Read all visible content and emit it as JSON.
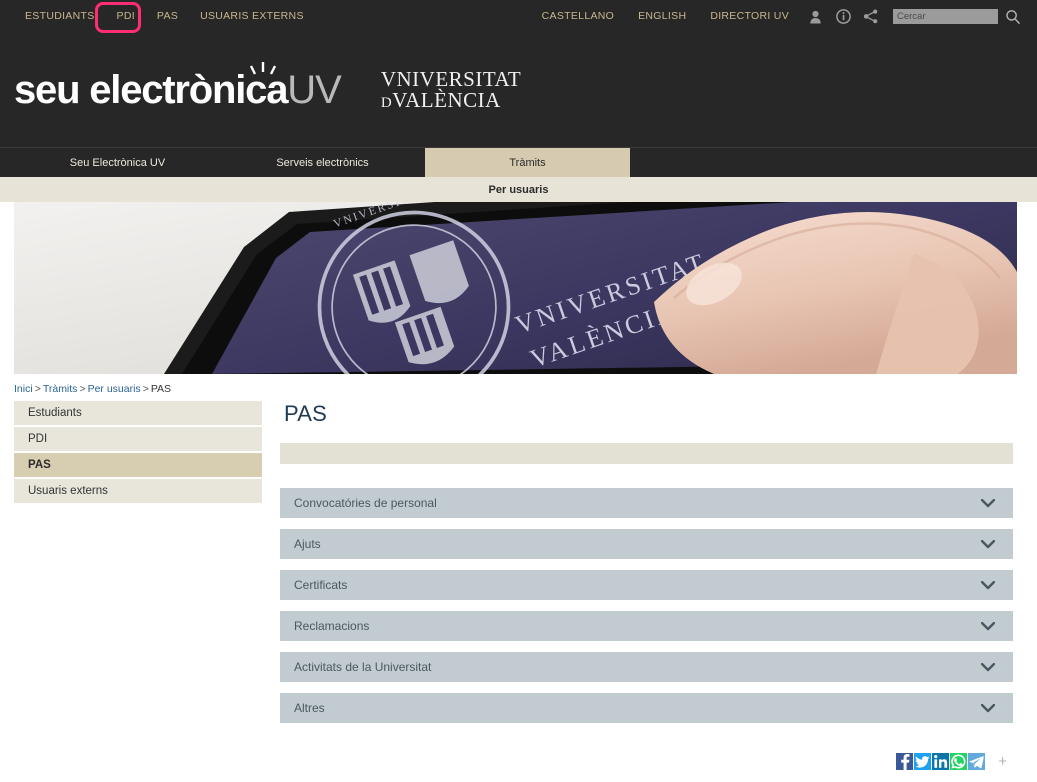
{
  "topbar": {
    "left_links": [
      {
        "label": "ESTUDIANTS",
        "name": "topnav-estudiants"
      },
      {
        "label": "PDI",
        "name": "topnav-pdi"
      },
      {
        "label": "PAS",
        "name": "topnav-pas"
      },
      {
        "label": "USUARIS EXTERNS",
        "name": "topnav-usuaris-externs"
      }
    ],
    "right_links": [
      {
        "label": "CASTELLANO",
        "name": "topnav-castellano"
      },
      {
        "label": "ENGLISH",
        "name": "topnav-english"
      },
      {
        "label": "DIRECTORI UV",
        "name": "topnav-directori-uv"
      }
    ],
    "icons": [
      "user-icon",
      "info-icon",
      "share-icon"
    ],
    "search": {
      "placeholder": "Cercar",
      "value": ""
    },
    "highlight_color": "#ff2d72",
    "highlighted_item": "PAS"
  },
  "banner": {
    "logo_main": "seu electr",
    "logo_mid": "nica",
    "logo_suffix": "UV",
    "wordmark_line1": "VNIVERSITAT",
    "wordmark_line2_small": "D",
    "wordmark_line2": "VALÈNCIA"
  },
  "mainnav": {
    "tabs": [
      {
        "label": "Seu Electrònica UV",
        "name": "tab-seu-electronica-uv",
        "active": false
      },
      {
        "label": "Serveis electrònics",
        "name": "tab-serveis-electronics",
        "active": false
      },
      {
        "label": "Tràmits",
        "name": "tab-tramits",
        "active": true
      }
    ],
    "active_tab_bg": "#d6cbb0"
  },
  "subnav": {
    "label": "Per usuaris"
  },
  "hero": {
    "alt": "Tablet amb segell de la Universitat de València tocat amb el dit"
  },
  "breadcrumb": {
    "items": [
      {
        "label": "Inici",
        "link": true
      },
      {
        "label": "Tràmits",
        "link": true
      },
      {
        "label": "Per usuaris",
        "link": true
      },
      {
        "label": "PAS",
        "link": false
      }
    ],
    "separator": ">"
  },
  "sidebar": {
    "items": [
      {
        "label": "Estudiants",
        "name": "sidebar-item-estudiants",
        "active": false
      },
      {
        "label": "PDI",
        "name": "sidebar-item-pdi",
        "active": false
      },
      {
        "label": "PAS",
        "name": "sidebar-item-pas",
        "active": true
      },
      {
        "label": "Usuaris externs",
        "name": "sidebar-item-usuaris-externs",
        "active": false
      }
    ]
  },
  "main": {
    "page_title": "PAS",
    "accordion": [
      {
        "label": "Convocatóries de personal",
        "name": "accordion-convocatories-de-personal",
        "expanded": false
      },
      {
        "label": "Ajuts",
        "name": "accordion-ajuts",
        "expanded": false
      },
      {
        "label": "Certificats",
        "name": "accordion-certificats",
        "expanded": false
      },
      {
        "label": "Reclamacions",
        "name": "accordion-reclamacions",
        "expanded": false
      },
      {
        "label": "Activitats de la Universitat",
        "name": "accordion-activitats-de-la-universitat",
        "expanded": false
      },
      {
        "label": "Altres",
        "name": "accordion-altres",
        "expanded": false
      }
    ],
    "accordion_bg": "#c1cbd0"
  },
  "footer": {
    "social": [
      {
        "name": "facebook-icon",
        "glyph": "f",
        "color": "#3b5998"
      },
      {
        "name": "twitter-icon",
        "glyph": "t",
        "color": "#1da1f2"
      },
      {
        "name": "linkedin-icon",
        "glyph": "in",
        "color": "#0d76a8"
      },
      {
        "name": "whatsapp-icon",
        "glyph": "w",
        "color": "#25d366"
      },
      {
        "name": "telegram-icon",
        "glyph": "tg",
        "color": "#62aade"
      }
    ],
    "more_label": "+"
  }
}
